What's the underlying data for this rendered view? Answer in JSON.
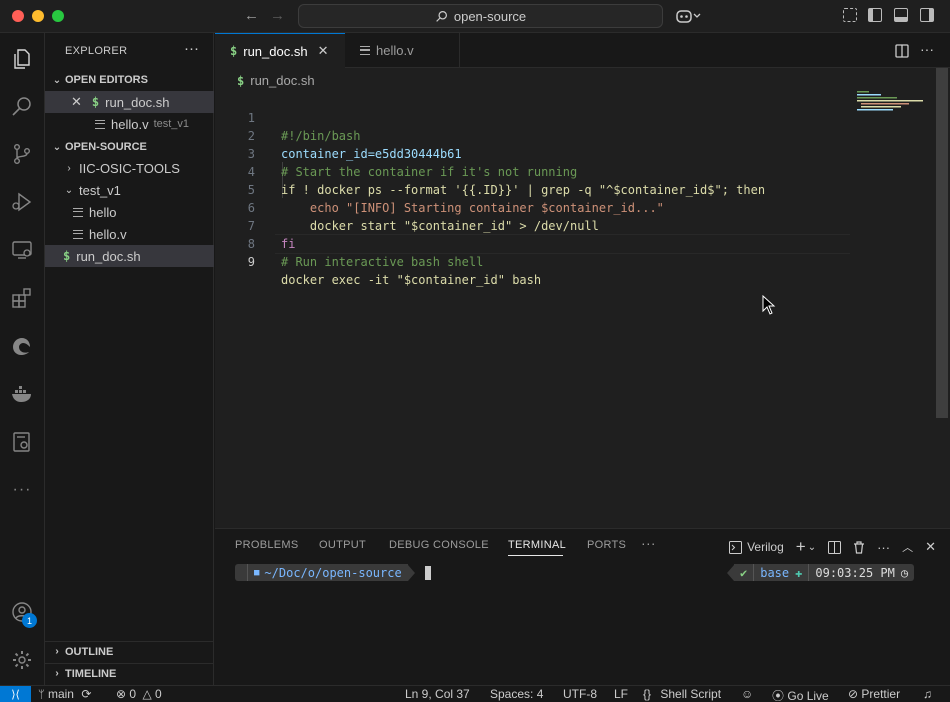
{
  "titlebar": {
    "search_text": "open-source"
  },
  "sidebar": {
    "title": "EXPLORER",
    "open_editors_label": "OPEN EDITORS",
    "open_editors": [
      {
        "name": "run_doc.sh",
        "detail": ""
      },
      {
        "name": "hello.v",
        "detail": "test_v1"
      }
    ],
    "workspace_label": "OPEN-SOURCE",
    "tree": [
      {
        "name": "IIC-OSIC-TOOLS"
      },
      {
        "name": "test_v1"
      },
      {
        "name": "hello"
      },
      {
        "name": "hello.v"
      },
      {
        "name": "run_doc.sh"
      }
    ],
    "outline_label": "OUTLINE",
    "timeline_label": "TIMELINE"
  },
  "tabs": [
    {
      "label": "run_doc.sh"
    },
    {
      "label": "hello.v"
    }
  ],
  "editor": {
    "breadcrumb": "run_doc.sh",
    "line_numbers": [
      "1",
      "2",
      "3",
      "4",
      "5",
      "6",
      "7",
      "8",
      "9"
    ],
    "lines": [
      "#!/bin/bash",
      "container_id=e5dd30444b61",
      "# Start the container if it's not running",
      "if ! docker ps --format '{{.ID}}' | grep -q \"^$container_id$\"; then",
      "    echo \"[INFO] Starting container $container_id...\"",
      "    docker start \"$container_id\" > /dev/null",
      "fi",
      "# Run interactive bash shell",
      "docker exec -it \"$container_id\" bash"
    ]
  },
  "panel": {
    "tabs": [
      "PROBLEMS",
      "OUTPUT",
      "DEBUG CONSOLE",
      "TERMINAL",
      "PORTS"
    ],
    "active_tab": "TERMINAL",
    "terminal_name": "Verilog",
    "prompt_path": "~/Doc/o/open-source",
    "prompt_check": "✔",
    "prompt_env": "base",
    "prompt_time": "09:03:25 PM"
  },
  "statusbar": {
    "branch": "main",
    "errors": "0",
    "warnings": "0",
    "position": "Ln 9, Col 37",
    "spaces": "Spaces: 4",
    "encoding": "UTF-8",
    "eol": "LF",
    "language": "Shell Script",
    "golive": "Go Live",
    "prettier": "Prettier"
  },
  "accounts_badge": "1",
  "colors": {
    "accent": "#0078d4",
    "shell_icon": "#89d185"
  }
}
